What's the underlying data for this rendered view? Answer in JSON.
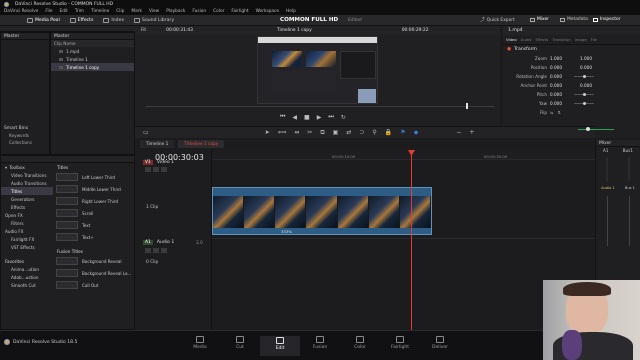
{
  "app": {
    "window_title": "DaVinci Resolve Studio - COMMON FULL HD",
    "menus": [
      "DaVinci Resolve",
      "File",
      "Edit",
      "Trim",
      "Timeline",
      "Clip",
      "Mark",
      "View",
      "Playback",
      "Fusion",
      "Color",
      "Fairlight",
      "Workspace",
      "Help"
    ],
    "project_title": "COMMON FULL HD",
    "edited_tag": "Edited",
    "version_label": "DaVinci Resolve Studio 18.5"
  },
  "toolbar": {
    "media_pool": "Media Pool",
    "effects": "Effects",
    "index": "Index",
    "sound_library": "Sound Library",
    "quick_export": "Quick Export",
    "mixer": "Mixer",
    "metadata": "Metadata",
    "inspector": "Inspector"
  },
  "media_pool": {
    "master_header": "Master",
    "col_header": "Clip Name",
    "master_bin": "Master",
    "clips": [
      "1.mp4",
      "Timeline 1",
      "Timeline 1 copy"
    ],
    "smart_bins": "Smart Bins",
    "smart_items": [
      "Keywords",
      "Collections"
    ]
  },
  "viewer": {
    "zoom": "Fit",
    "src_timecode": "00:00:31:43",
    "timeline_name": "Timeline 1 copy",
    "rec_timecode": "00:00:29:22"
  },
  "inspector": {
    "clip_name": "1.mp4",
    "tabs": [
      "Video",
      "Audio",
      "Effects",
      "Transition",
      "Image",
      "File"
    ],
    "section": "Transform",
    "params": [
      {
        "label": "Zoom",
        "x": "1.000",
        "y": "1.000"
      },
      {
        "label": "Position",
        "x": "0.000",
        "y": "0.000"
      },
      {
        "label": "Rotation Angle",
        "x": "0.000",
        "y": ""
      },
      {
        "label": "Anchor Point",
        "x": "0.000",
        "y": "0.000"
      },
      {
        "label": "Pitch",
        "x": "0.000",
        "y": ""
      },
      {
        "label": "Yaw",
        "x": "0.000",
        "y": ""
      },
      {
        "label": "Flip",
        "x": "",
        "y": ""
      }
    ]
  },
  "timeline": {
    "tabs": [
      "Timeline 1",
      "Timeline 1 copy"
    ],
    "timecode": "00:00:30:03",
    "ruler_marks": [
      "00:00:15:00",
      "00:00:30:00",
      "00:00:45:00"
    ],
    "video_track_id": "V1",
    "video_track_name": "Video 1",
    "video_clip_count": "1 Clip",
    "audio_track_id": "A1",
    "audio_track_name": "Audio 1",
    "audio_level": "2.0",
    "audio_clip_count": "0 Clip",
    "clip_speed": "333%"
  },
  "mixer": {
    "title": "Mixer",
    "channels": [
      "A1",
      "Bus1"
    ],
    "channel_names": [
      "Audio 1",
      "Bus 1"
    ]
  },
  "effects": {
    "toolbox": "Toolbox",
    "categories": [
      "Video Transitions",
      "Audio Transitions",
      "Titles",
      "Generators",
      "Effects",
      "Open FX",
      "Filters",
      "Audio FX",
      "Fairlight FX",
      "VST Effects"
    ],
    "favorites": "Favorites",
    "favorite_items": [
      "Anima...ution",
      "Adob...ustion",
      "Smooth Cut"
    ],
    "titles_header": "Titles",
    "titles": [
      "Left Lower Third",
      "Middle Lower Third",
      "Right Lower Third",
      "Scroll",
      "Text",
      "Text+"
    ],
    "fusion_header": "Fusion Titles",
    "fusion_titles": [
      "Background Reveal",
      "Background Reveal Lo...",
      "Call Out"
    ]
  },
  "pages": [
    "Media",
    "Cut",
    "Edit",
    "Fusion",
    "Color",
    "Fairlight",
    "Deliver"
  ],
  "active_page": "Edit",
  "colors": {
    "accent": "#e64b3c",
    "clip_video": "#2d5d84",
    "panel": "#1f1f22"
  }
}
